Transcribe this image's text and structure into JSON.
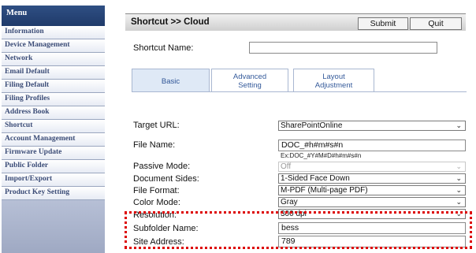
{
  "sidebar": {
    "title": "Menu",
    "items": [
      {
        "label": "Information"
      },
      {
        "label": "Device Management"
      },
      {
        "label": "Network"
      },
      {
        "label": "Email Default"
      },
      {
        "label": "Filing Default"
      },
      {
        "label": "Filing Profiles"
      },
      {
        "label": "Address Book"
      },
      {
        "label": "Shortcut"
      },
      {
        "label": "Account Management"
      },
      {
        "label": "Firmware Update"
      },
      {
        "label": "Public Folder"
      },
      {
        "label": "Import/Export"
      },
      {
        "label": "Product Key Setting"
      }
    ]
  },
  "header": {
    "breadcrumb": "Shortcut >> Cloud",
    "submit_label": "Submit",
    "quit_label": "Quit"
  },
  "form": {
    "shortcut_name_label": "Shortcut Name:",
    "shortcut_name_value": "",
    "tabs": [
      {
        "label": "Basic"
      },
      {
        "line1": "Advanced",
        "line2": "Setting"
      },
      {
        "line1": "Layout",
        "line2": "Adjustment"
      }
    ],
    "target_url_label": "Target URL:",
    "target_url_value": "SharePointOnline",
    "file_name_label": "File Name:",
    "file_name_value": "DOC_#h#m#s#n",
    "file_name_hint": "Ex:DOC_#Y#M#D#h#m#s#n",
    "passive_mode_label": "Passive Mode:",
    "passive_mode_value": "Off",
    "document_sides_label": "Document Sides:",
    "document_sides_value": "1-Sided Face Down",
    "file_format_label": "File Format:",
    "file_format_value": "M-PDF (Multi-page PDF)",
    "color_mode_label": "Color Mode:",
    "color_mode_value": "Gray",
    "resolution_label": "Resolution:",
    "resolution_value": "300 dpi",
    "subfolder_name_label": "Subfolder Name:",
    "subfolder_name_value": "bess",
    "site_address_label": "Site Address:",
    "site_address_value": "789"
  },
  "colors": {
    "sidebar_header": "#1f3a6a",
    "sidebar_text": "#3b4c77",
    "tab_text": "#345a9a",
    "highlight": "#dd0000"
  }
}
